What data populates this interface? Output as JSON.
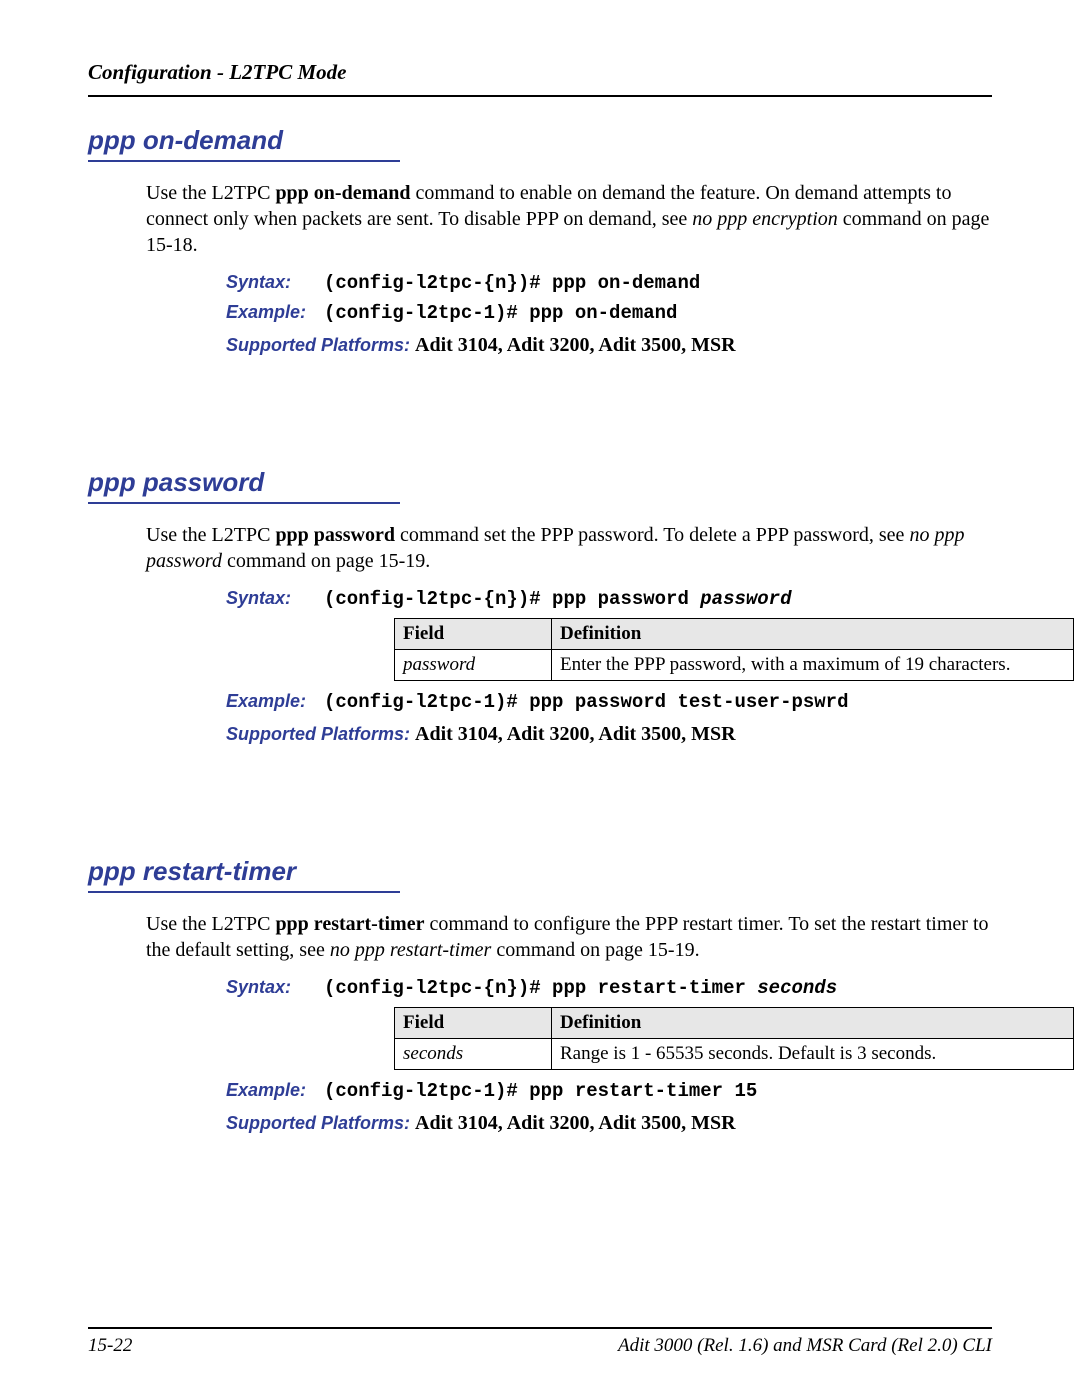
{
  "running_head": "Configuration - L2TPC Mode",
  "footer": {
    "page_num": "15-22",
    "doc_title": "Adit 3000 (Rel. 1.6) and MSR Card (Rel 2.0) CLI"
  },
  "labels": {
    "syntax": "Syntax:",
    "example": "Example:",
    "supported": "Supported Platforms:",
    "field": "Field",
    "definition": "Definition"
  },
  "sections": [
    {
      "title": "ppp on-demand",
      "para": [
        {
          "t": "Use the L2TPC "
        },
        {
          "t": "ppp on-demand",
          "b": true
        },
        {
          "t": " command to enable on demand the feature. On demand attempts to connect only when packets are sent. To disable PPP on demand, see "
        },
        {
          "t": "no ppp encryption",
          "i": true
        },
        {
          "t": " command on page 15-18."
        }
      ],
      "syntax_code": [
        {
          "t": "(config-l2tpc-{n})# ppp on-demand"
        }
      ],
      "example_code": [
        {
          "t": "(config-l2tpc-1)# ppp on-demand"
        }
      ],
      "supported": "Adit 3104, Adit 3200, Adit 3500, MSR"
    },
    {
      "title": "ppp password",
      "para": [
        {
          "t": "Use the L2TPC "
        },
        {
          "t": "ppp password",
          "b": true
        },
        {
          "t": " command set the PPP password. To delete a PPP password, see "
        },
        {
          "t": "no ppp password",
          "i": true
        },
        {
          "t": " command on page 15-19."
        }
      ],
      "syntax_code": [
        {
          "t": "(config-l2tpc-{n})# ppp password "
        },
        {
          "t": "password",
          "arg": true
        }
      ],
      "table": [
        {
          "field": "password",
          "definition": "Enter the PPP password, with a maximum of 19 characters."
        }
      ],
      "example_code": [
        {
          "t": "(config-l2tpc-1)# ppp password test-user-pswrd"
        }
      ],
      "supported": "Adit 3104, Adit 3200, Adit 3500, MSR"
    },
    {
      "title": "ppp restart-timer",
      "para": [
        {
          "t": "Use the L2TPC "
        },
        {
          "t": "ppp restart-timer",
          "b": true
        },
        {
          "t": " command to configure the PPP restart timer. To set the restart timer to the default setting, see "
        },
        {
          "t": "no ppp restart-timer",
          "i": true
        },
        {
          "t": " command on page 15-19."
        }
      ],
      "syntax_code": [
        {
          "t": "(config-l2tpc-{n})# ppp restart-timer "
        },
        {
          "t": "seconds",
          "arg": true
        }
      ],
      "table": [
        {
          "field": "seconds",
          "definition": "Range is 1 - 65535 seconds. Default is 3 seconds."
        }
      ],
      "example_code": [
        {
          "t": "(config-l2tpc-1)# ppp restart-timer 15"
        }
      ],
      "supported": "Adit 3104, Adit 3200, Adit 3500, MSR"
    }
  ]
}
